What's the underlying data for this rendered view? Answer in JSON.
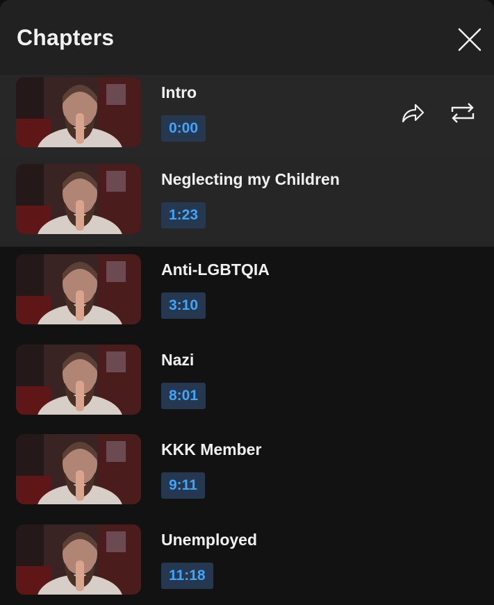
{
  "header": {
    "title": "Chapters",
    "close_icon": "close-icon"
  },
  "chapters": [
    {
      "title": "Intro",
      "timestamp": "0:00",
      "active": true
    },
    {
      "title": "Neglecting my Children",
      "timestamp": "1:23"
    },
    {
      "title": "Anti-LGBTQIA",
      "timestamp": "3:10"
    },
    {
      "title": "Nazi",
      "timestamp": "8:01"
    },
    {
      "title": "KKK Member",
      "timestamp": "9:11"
    },
    {
      "title": "Unemployed",
      "timestamp": "11:18"
    }
  ],
  "actions": {
    "share_icon": "share-icon",
    "loop_icon": "loop-icon"
  },
  "colors": {
    "timestamp_text": "#3ea6ff",
    "timestamp_bg": "#263850",
    "header_bg": "#212121",
    "active_row_bg": "#272727"
  }
}
